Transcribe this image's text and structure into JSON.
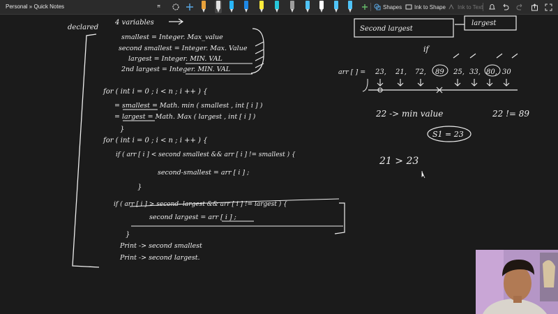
{
  "toolbar": {
    "breadcrumb": "Personal » Quick Notes",
    "shapes_label": "Shapes",
    "ink_to_shape_label": "Ink to Shape",
    "ink_to_text_label": "Ink to Text",
    "pen_colors": [
      "#e8a13a",
      "#e1e1e1",
      "#2c2c2c",
      "#29b6f6",
      "#1e88e5",
      "#ffeb3b",
      "#26c6da",
      "#9e9e9e",
      "#4fc3f7",
      "#ffffff",
      "#4fc3f7",
      "#4fc3f7"
    ]
  },
  "notes": {
    "top_partial": "declared",
    "variables_header": "4 variables",
    "decl_1": "smallest = Integer. Max_value",
    "decl_2": "second smallest = Integer. Max. Value",
    "decl_3": "largest = Integer. MIN. VAL",
    "decl_4": "2nd largest = Integer. MIN. VAL",
    "loop1_header": "for ( int i = 0 ; i < n ; i ++ ) {",
    "loop1_line1": "= smallest = Math. min ( smallest , int [ i ] )",
    "loop1_line2": "= largest = Math. Max ( largest , int [ i ] )",
    "loop2_header": "for ( int i = 0 ; i < n ; i ++ ) {",
    "if1": "if ( arr [ i ] < second smallest && arr [ i ] != smallest ) {",
    "if1_body": "second-smallest = arr [ i ] ;",
    "if2": "if ( arr [ i ] > second- largest && arr [ i ] != largest ) {",
    "if2_body": "second largest = arr [ i ] ;",
    "print1": "Print -> second smallest",
    "print2": "Print -> second largest.",
    "box_second_largest": "Second largest",
    "box_largest": "largest",
    "if_label": "if",
    "array_label": "arr [ ] =",
    "array_values": [
      "23,",
      "21,",
      "72,",
      "89",
      "25,",
      "33,",
      "80,",
      "30"
    ],
    "min_note": "22 -> min value",
    "neq_note": "22 != 89",
    "s1_note": "S1 = 23",
    "compare_note": "21 > 23"
  }
}
